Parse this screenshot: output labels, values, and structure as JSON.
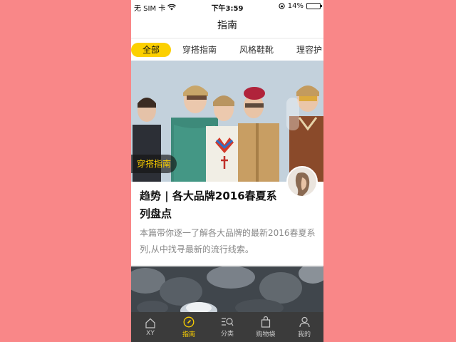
{
  "status_bar": {
    "carrier": "无 SIM 卡",
    "time": "下午3:59",
    "battery": "14%",
    "battery_level": 0.14
  },
  "nav": {
    "title": "指南"
  },
  "tabs": [
    {
      "label": "全部",
      "active": true
    },
    {
      "label": "穿搭指南",
      "active": false
    },
    {
      "label": "风格鞋靴",
      "active": false
    },
    {
      "label": "理容护",
      "active": false
    }
  ],
  "card": {
    "category": "穿搭指南",
    "title": "趋势 | 各大品牌2016春夏系列盘点",
    "description": "本篇带你逐一了解各大品牌的最新2016春夏系列,从中找寻最新的流行线索。"
  },
  "tab_bar": [
    {
      "label": "XY",
      "icon": "home-icon",
      "active": false
    },
    {
      "label": "指南",
      "icon": "compass-icon",
      "active": true
    },
    {
      "label": "分类",
      "icon": "list-search-icon",
      "active": false
    },
    {
      "label": "购物袋",
      "icon": "shopping-bag-icon",
      "active": false
    },
    {
      "label": "我的",
      "icon": "user-icon",
      "active": false
    }
  ],
  "colors": {
    "accent": "#fcd000",
    "background": "#f98788",
    "tab_bar": "#3b3b3b"
  }
}
